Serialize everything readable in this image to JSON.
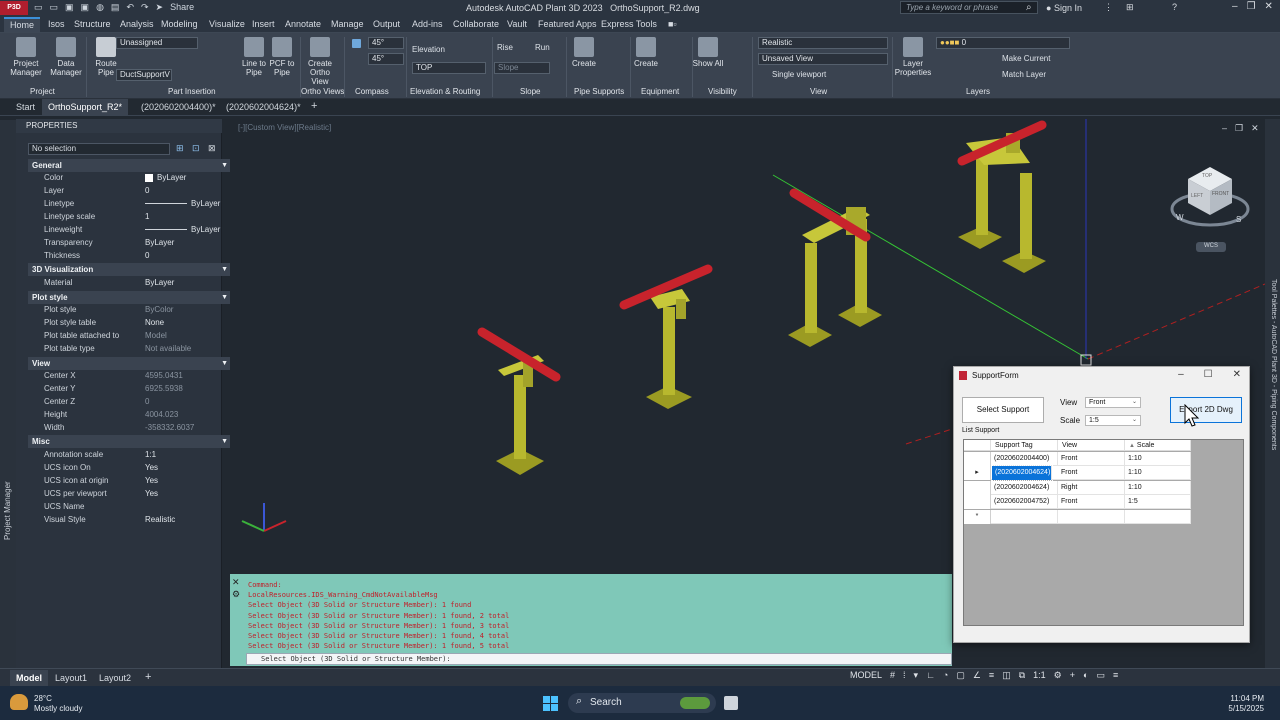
{
  "app": {
    "badge": "P3D",
    "title": "Autodesk AutoCAD Plant 3D 2023",
    "file": "OrthoSupport_R2.dwg",
    "share": "Share",
    "search_placeholder": "Type a keyword or phrase",
    "sign_in": "Sign In"
  },
  "menu": [
    "Home",
    "Isos",
    "Structure",
    "Analysis",
    "Modeling",
    "Visualize",
    "Insert",
    "Annotate",
    "Manage",
    "Output",
    "Add-ins",
    "Collaborate",
    "Vault",
    "Featured Apps",
    "Express Tools"
  ],
  "ribbon": {
    "project_manager": "Project Manager",
    "data_manager": "Data Manager",
    "panel_project": "Project",
    "unassigned": "Unassigned",
    "duct_support": "DuctSupportV",
    "route_pipe": "Route Pipe",
    "line_to_pipe": "Line to Pipe",
    "pcf_to_pipe": "PCF to Pipe",
    "panel_part_insertion": "Part Insertion",
    "create_ortho_view": "Create Ortho View",
    "panel_ortho_views": "Ortho Views",
    "compass_angle1": "45°",
    "compass_angle2": "45°",
    "panel_compass": "Compass",
    "elevation": "Elevation",
    "top": "TOP",
    "panel_elevation_routing": "Elevation & Routing",
    "rise": "Rise",
    "run": "Run",
    "slope": "Slope",
    "panel_slope": "Slope",
    "create_support": "Create",
    "panel_pipe_supports": "Pipe Supports",
    "create_equipment": "Create",
    "panel_equipment": "Equipment",
    "show_all": "Show All",
    "panel_visibility": "Visibility",
    "visual_style": "Realistic",
    "unsaved_view": "Unsaved View",
    "single_viewport": "Single viewport",
    "panel_view": "View",
    "layer_properties": "Layer Properties",
    "layer_value": "0",
    "make_current": "Make Current",
    "match_layer": "Match Layer",
    "panel_layers": "Layers"
  },
  "doc_tabs": [
    "Start",
    "OrthoSupport_R2*",
    "(2020602004400)*",
    "(2020602004624)*"
  ],
  "properties": {
    "title": "PROPERTIES",
    "selection": "No selection",
    "sections": {
      "general": "General",
      "visualization": "3D Visualization",
      "plot_style": "Plot style",
      "view": "View",
      "misc": "Misc"
    },
    "general": [
      [
        "Color",
        "ByLayer"
      ],
      [
        "Layer",
        "0"
      ],
      [
        "Linetype",
        "ByLayer"
      ],
      [
        "Linetype scale",
        "1"
      ],
      [
        "Lineweight",
        "ByLayer"
      ],
      [
        "Transparency",
        "ByLayer"
      ],
      [
        "Thickness",
        "0"
      ]
    ],
    "visualization": [
      [
        "Material",
        "ByLayer"
      ]
    ],
    "plot": [
      [
        "Plot style",
        "ByColor"
      ],
      [
        "Plot style table",
        "None"
      ],
      [
        "Plot table attached to",
        "Model"
      ],
      [
        "Plot table type",
        "Not available"
      ]
    ],
    "view": [
      [
        "Center X",
        "4595.0431"
      ],
      [
        "Center Y",
        "6925.5938"
      ],
      [
        "Center Z",
        "0"
      ],
      [
        "Height",
        "4004.023"
      ],
      [
        "Width",
        "-358332.6037"
      ]
    ],
    "misc": [
      [
        "Annotation scale",
        "1:1"
      ],
      [
        "UCS icon On",
        "Yes"
      ],
      [
        "UCS icon at origin",
        "Yes"
      ],
      [
        "UCS per viewport",
        "Yes"
      ],
      [
        "UCS Name",
        ""
      ],
      [
        "Visual Style",
        "Realistic"
      ]
    ]
  },
  "left_strip": "Project Manager",
  "right_strip": "Tool Palettes - AutoCAD Plant 3D - Piping Components",
  "viewport": {
    "label": "[-][Custom View][Realistic]",
    "viewcube_top": "TOP",
    "viewcube_left": "LEFT",
    "viewcube_front": "FRONT",
    "wcs": "WCS",
    "w": "W",
    "s": "S"
  },
  "command": {
    "history": [
      "Command:",
      "LocalResources.IDS_Warning_CmdNotAvailableMsg",
      "Select Object (3D Solid or Structure Member): 1 found",
      "Select Object (3D Solid or Structure Member): 1 found, 2 total",
      "Select Object (3D Solid or Structure Member): 1 found, 3 total",
      "Select Object (3D Solid or Structure Member): 1 found, 4 total",
      "Select Object (3D Solid or Structure Member): 1 found, 5 total"
    ],
    "prompt": "Select Object (3D Solid or Structure Member):"
  },
  "support_form": {
    "title": "SupportForm",
    "select_support": "Select Support",
    "view_label": "View",
    "view_value": "Front",
    "scale_label": "Scale",
    "scale_value": "1:5",
    "export_button": "Export 2D Dwg",
    "list_label": "List Support",
    "columns": [
      "Support Tag",
      "View",
      "Scale"
    ],
    "rows": [
      [
        "(2020602004400)",
        "Front",
        "1:10"
      ],
      [
        "(2020602004624)",
        "Front",
        "1:10"
      ],
      [
        "(2020602004624)",
        "Right",
        "1:10"
      ],
      [
        "(2020602004752)",
        "Front",
        "1:5"
      ]
    ],
    "selected_row": 1,
    "new_row_marker": "*",
    "current_row_marker": "▸"
  },
  "model_tabs": [
    "Model",
    "Layout1",
    "Layout2"
  ],
  "status": {
    "model": "MODEL",
    "scale": "1:1"
  },
  "taskbar": {
    "temp": "28°C",
    "weather": "Mostly cloudy",
    "search": "Search",
    "time": "11:04 PM",
    "date": "5/15/2025"
  },
  "colors": {
    "pipe": "#c8232c",
    "support": "#b8b82e",
    "accent": "#0a73d9"
  }
}
